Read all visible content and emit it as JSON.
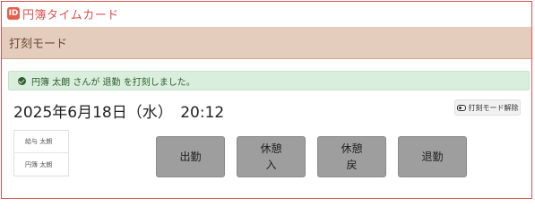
{
  "app": {
    "logo_text": "ID",
    "title": "円簿タイムカード"
  },
  "mode_bar": {
    "title": "打刻モード"
  },
  "alert": {
    "message": "円簿 太朗 さんが 退勤 を打刻しました。"
  },
  "clock": {
    "datetime": "2025年6月18日（水）　20:12"
  },
  "release_button": {
    "label": "打刻モード解除"
  },
  "users": [
    {
      "name": "給与 太朗"
    },
    {
      "name": "円簿 太朗"
    }
  ],
  "punch_buttons": [
    {
      "line1": "出勤",
      "line2": ""
    },
    {
      "line1": "休憩",
      "line2": "入"
    },
    {
      "line1": "休憩",
      "line2": "戻"
    },
    {
      "line1": "退勤",
      "line2": ""
    }
  ],
  "colors": {
    "accent": "#d9534f",
    "mode_bar_bg": "#e4cdbd",
    "alert_bg": "#d9eedc",
    "button_bg": "#9e9e9e"
  }
}
